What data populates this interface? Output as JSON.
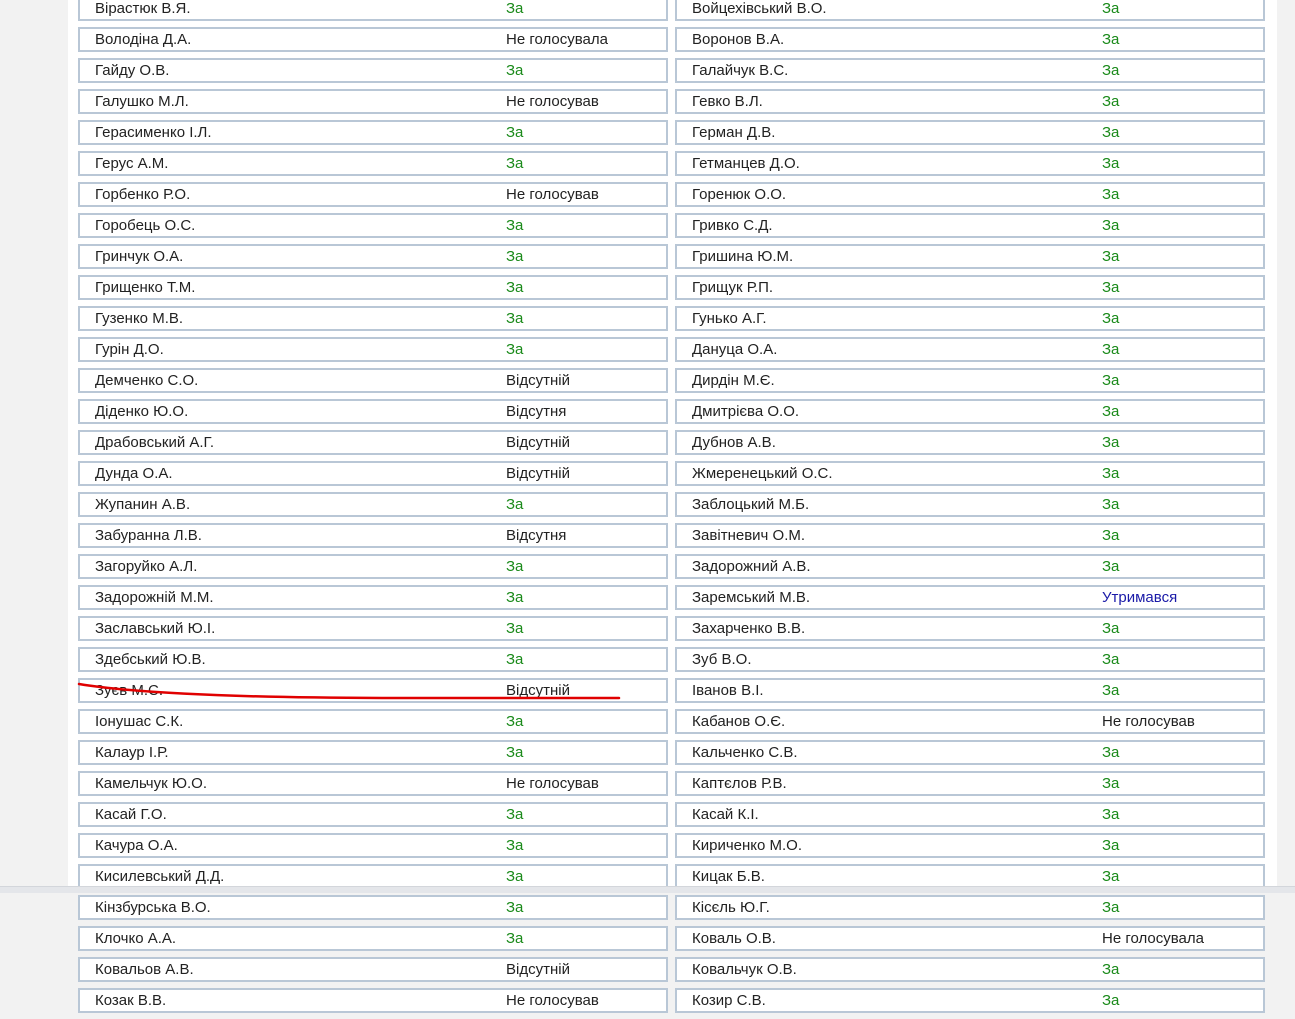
{
  "colors": {
    "for": "#1a8a1a",
    "abstain": "#1a1aa8",
    "default": "#222222",
    "border": "#b9c7d6",
    "annotation": "#e00000"
  },
  "left_column": [
    {
      "name": "Вірастюк В.Я.",
      "vote": "За"
    },
    {
      "name": "Володіна Д.А.",
      "vote": "Не голосувала"
    },
    {
      "name": "Гайду О.В.",
      "vote": "За"
    },
    {
      "name": "Галушко М.Л.",
      "vote": "Не голосував"
    },
    {
      "name": "Герасименко І.Л.",
      "vote": "За"
    },
    {
      "name": "Герус А.М.",
      "vote": "За"
    },
    {
      "name": "Горбенко Р.О.",
      "vote": "Не голосував"
    },
    {
      "name": "Горобець О.С.",
      "vote": "За"
    },
    {
      "name": "Гринчук О.А.",
      "vote": "За"
    },
    {
      "name": "Грищенко Т.М.",
      "vote": "За"
    },
    {
      "name": "Гузенко М.В.",
      "vote": "За"
    },
    {
      "name": "Гурін Д.О.",
      "vote": "За"
    },
    {
      "name": "Демченко С.О.",
      "vote": "Відсутній"
    },
    {
      "name": "Діденко Ю.О.",
      "vote": "Відсутня"
    },
    {
      "name": "Драбовський А.Г.",
      "vote": "Відсутній"
    },
    {
      "name": "Дунда О.А.",
      "vote": "Відсутній"
    },
    {
      "name": "Жупанин А.В.",
      "vote": "За"
    },
    {
      "name": "Забуранна Л.В.",
      "vote": "Відсутня"
    },
    {
      "name": "Загоруйко А.Л.",
      "vote": "За"
    },
    {
      "name": "Задорожній М.М.",
      "vote": "За"
    },
    {
      "name": "Заславський Ю.І.",
      "vote": "За"
    },
    {
      "name": "Здебський Ю.В.",
      "vote": "За"
    },
    {
      "name": "Зуєв М.С.",
      "vote": "Відсутній"
    },
    {
      "name": "Іонушас С.К.",
      "vote": "За"
    },
    {
      "name": "Калаур І.Р.",
      "vote": "За"
    },
    {
      "name": "Камельчук Ю.О.",
      "vote": "Не голосував"
    },
    {
      "name": "Касай Г.О.",
      "vote": "За"
    },
    {
      "name": "Качура О.А.",
      "vote": "За"
    },
    {
      "name": "Кисилевський Д.Д.",
      "vote": "За"
    },
    {
      "name": "Кінзбурська В.О.",
      "vote": "За"
    },
    {
      "name": "Клочко А.А.",
      "vote": "За"
    },
    {
      "name": "Ковальов А.В.",
      "vote": "Відсутній"
    },
    {
      "name": "Козак В.В.",
      "vote": "Не голосував"
    }
  ],
  "right_column": [
    {
      "name": "Войцехівський В.О.",
      "vote": "За"
    },
    {
      "name": "Воронов В.А.",
      "vote": "За"
    },
    {
      "name": "Галайчук В.С.",
      "vote": "За"
    },
    {
      "name": "Гевко В.Л.",
      "vote": "За"
    },
    {
      "name": "Герман Д.В.",
      "vote": "За"
    },
    {
      "name": "Гетманцев Д.О.",
      "vote": "За"
    },
    {
      "name": "Горенюк О.О.",
      "vote": "За"
    },
    {
      "name": "Гривко С.Д.",
      "vote": "За"
    },
    {
      "name": "Гришина Ю.М.",
      "vote": "За"
    },
    {
      "name": "Грищук Р.П.",
      "vote": "За"
    },
    {
      "name": "Гунько А.Г.",
      "vote": "За"
    },
    {
      "name": "Дануца О.А.",
      "vote": "За"
    },
    {
      "name": "Дирдін М.Є.",
      "vote": "За"
    },
    {
      "name": "Дмитрієва О.О.",
      "vote": "За"
    },
    {
      "name": "Дубнов А.В.",
      "vote": "За"
    },
    {
      "name": "Жмеренецький О.С.",
      "vote": "За"
    },
    {
      "name": "Заблоцький М.Б.",
      "vote": "За"
    },
    {
      "name": "Завітневич О.М.",
      "vote": "За"
    },
    {
      "name": "Задорожний А.В.",
      "vote": "За"
    },
    {
      "name": "Заремський М.В.",
      "vote": "Утримався"
    },
    {
      "name": "Захарченко В.В.",
      "vote": "За"
    },
    {
      "name": "Зуб В.О.",
      "vote": "За"
    },
    {
      "name": "Іванов В.І.",
      "vote": "За"
    },
    {
      "name": "Кабанов О.Є.",
      "vote": "Не голосував"
    },
    {
      "name": "Кальченко С.В.",
      "vote": "За"
    },
    {
      "name": "Каптєлов Р.В.",
      "vote": "За"
    },
    {
      "name": "Касай К.І.",
      "vote": "За"
    },
    {
      "name": "Кириченко М.О.",
      "vote": "За"
    },
    {
      "name": "Кицак Б.В.",
      "vote": "За"
    },
    {
      "name": "Кісєль Ю.Г.",
      "vote": "За"
    },
    {
      "name": "Коваль О.В.",
      "vote": "Не голосувала"
    },
    {
      "name": "Ковальчук О.В.",
      "vote": "За"
    },
    {
      "name": "Козир С.В.",
      "vote": "За"
    }
  ]
}
